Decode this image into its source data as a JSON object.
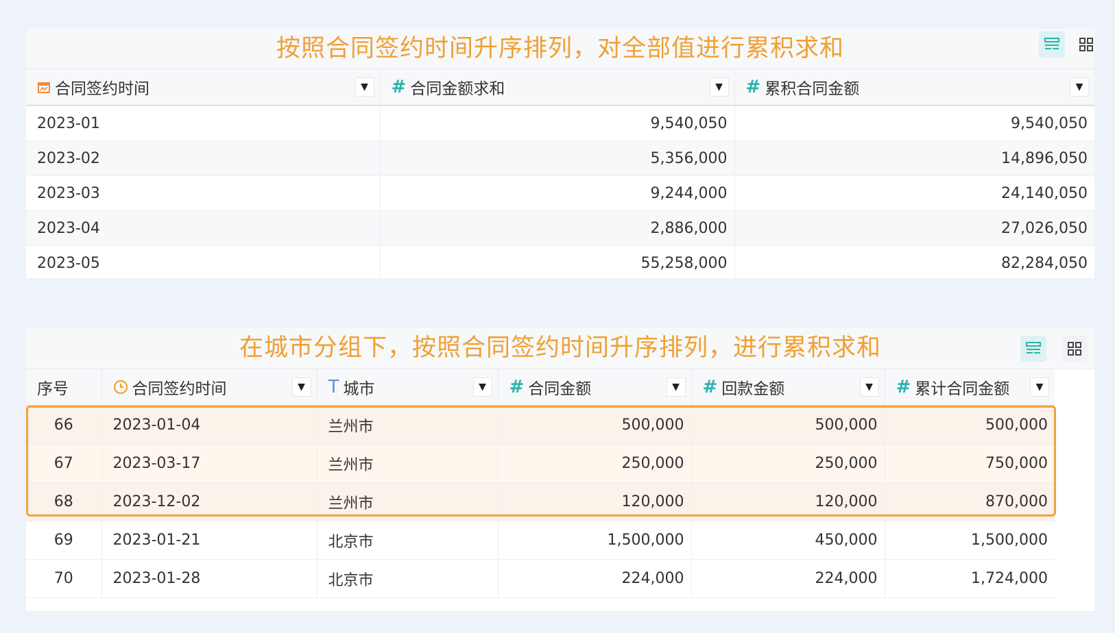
{
  "table1": {
    "caption": "按照合同签约时间升序排列，对全部值进行累积求和",
    "view_buttons": [
      "table-view-icon",
      "grid-view-icon"
    ],
    "columns": [
      {
        "icon": "date-icon",
        "label": "合同签约时间"
      },
      {
        "icon": "hash-icon",
        "label": "合同金额求和"
      },
      {
        "icon": "hash-icon",
        "label": "累积合同金额"
      }
    ],
    "rows": [
      [
        "2023-01",
        "9,540,050",
        "9,540,050"
      ],
      [
        "2023-02",
        "5,356,000",
        "14,896,050"
      ],
      [
        "2023-03",
        "9,244,000",
        "24,140,050"
      ],
      [
        "2023-04",
        "2,886,000",
        "27,026,050"
      ],
      [
        "2023-05",
        "55,258,000",
        "82,284,050"
      ]
    ]
  },
  "table2": {
    "caption": "在城市分组下，按照合同签约时间升序排列，进行累积求和",
    "view_buttons": [
      "table-view-icon",
      "grid-view-icon"
    ],
    "columns": [
      {
        "icon": "",
        "label": "序号"
      },
      {
        "icon": "clock-icon",
        "label": "合同签约时间"
      },
      {
        "icon": "text-icon",
        "label": "城市"
      },
      {
        "icon": "hash-icon",
        "label": "合同金额"
      },
      {
        "icon": "hash-icon",
        "label": "回款金额"
      },
      {
        "icon": "hash-icon",
        "label": "累计合同金额"
      }
    ],
    "rows": [
      [
        "66",
        "2023-01-04",
        "兰州市",
        "500,000",
        "500,000",
        "500,000"
      ],
      [
        "67",
        "2023-03-17",
        "兰州市",
        "250,000",
        "250,000",
        "750,000"
      ],
      [
        "68",
        "2023-12-02",
        "兰州市",
        "120,000",
        "120,000",
        "870,000"
      ],
      [
        "69",
        "2023-01-21",
        "北京市",
        "1,500,000",
        "450,000",
        "1,500,000"
      ],
      [
        "70",
        "2023-01-28",
        "北京市",
        "224,000",
        "224,000",
        "1,724,000"
      ]
    ],
    "highlight_color": "#f3a23a"
  },
  "colors": {
    "caption": "#f0a033",
    "accent": "#2bb3ac"
  }
}
